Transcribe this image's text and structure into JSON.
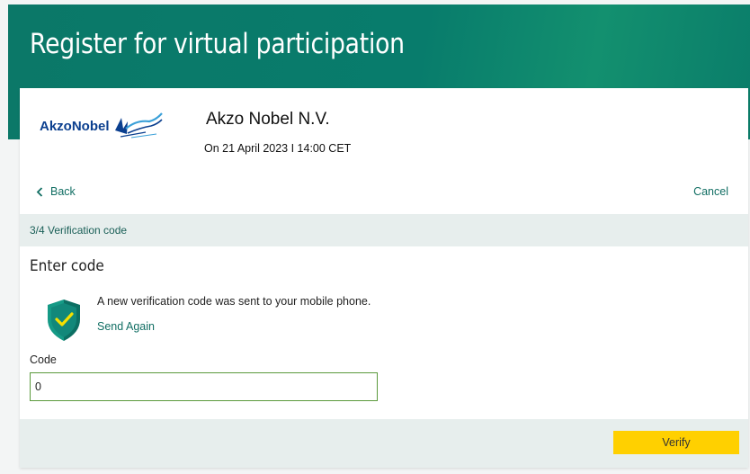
{
  "header": {
    "title": "Register for virtual participation"
  },
  "event": {
    "logo_text": "AkzoNobel",
    "company": "Akzo Nobel N.V.",
    "date": "On 21 April 2023 I 14:00 CET"
  },
  "nav": {
    "back_label": "Back",
    "cancel_label": "Cancel"
  },
  "step": {
    "label": "3/4 Verification code"
  },
  "form": {
    "title": "Enter code",
    "notice": "A new verification code was sent to your mobile phone.",
    "send_again": "Send Again",
    "code_label": "Code",
    "code_value": "0",
    "verify_label": "Verify"
  },
  "colors": {
    "brand": "#087c6c",
    "link": "#116e63",
    "accent": "#ffd000",
    "logo": "#0b3f8f"
  }
}
